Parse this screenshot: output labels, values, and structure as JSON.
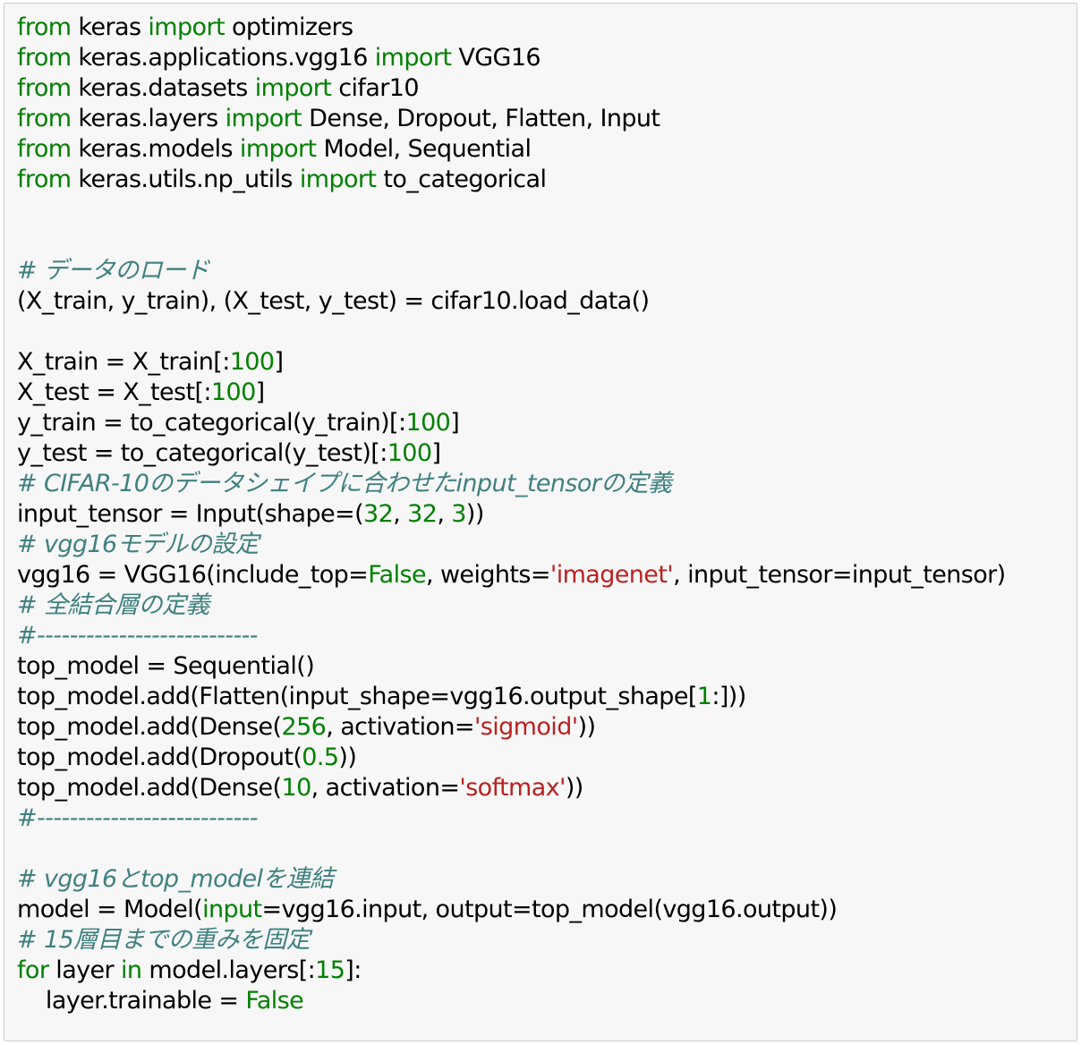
{
  "editor": {
    "colors": {
      "keyword": "#008000",
      "number": "#008000",
      "string": "#ba2121",
      "comment": "#408080",
      "text": "#000000",
      "background": "#f7f7f7",
      "border": "#cfcfcf"
    },
    "lines": [
      [
        {
          "t": "kw",
          "s": "from"
        },
        {
          "t": "tx",
          "s": " keras "
        },
        {
          "t": "kw",
          "s": "import"
        },
        {
          "t": "tx",
          "s": " optimizers"
        }
      ],
      [
        {
          "t": "kw",
          "s": "from"
        },
        {
          "t": "tx",
          "s": " keras.applications.vgg16 "
        },
        {
          "t": "kw",
          "s": "import"
        },
        {
          "t": "tx",
          "s": " VGG16"
        }
      ],
      [
        {
          "t": "kw",
          "s": "from"
        },
        {
          "t": "tx",
          "s": " keras.datasets "
        },
        {
          "t": "kw",
          "s": "import"
        },
        {
          "t": "tx",
          "s": " cifar10"
        }
      ],
      [
        {
          "t": "kw",
          "s": "from"
        },
        {
          "t": "tx",
          "s": " keras.layers "
        },
        {
          "t": "kw",
          "s": "import"
        },
        {
          "t": "tx",
          "s": " Dense, Dropout, Flatten, Input"
        }
      ],
      [
        {
          "t": "kw",
          "s": "from"
        },
        {
          "t": "tx",
          "s": " keras.models "
        },
        {
          "t": "kw",
          "s": "import"
        },
        {
          "t": "tx",
          "s": " Model, Sequential"
        }
      ],
      [
        {
          "t": "kw",
          "s": "from"
        },
        {
          "t": "tx",
          "s": " keras.utils.np_utils "
        },
        {
          "t": "kw",
          "s": "import"
        },
        {
          "t": "tx",
          "s": " to_categorical"
        }
      ],
      [],
      [],
      [
        {
          "t": "cm",
          "s": "# データのロード"
        }
      ],
      [
        {
          "t": "tx",
          "s": "(X_train, y_train), (X_test, y_test) = cifar10.load_data()"
        }
      ],
      [],
      [
        {
          "t": "tx",
          "s": "X_train = X_train[:"
        },
        {
          "t": "num",
          "s": "100"
        },
        {
          "t": "tx",
          "s": "]"
        }
      ],
      [
        {
          "t": "tx",
          "s": "X_test = X_test[:"
        },
        {
          "t": "num",
          "s": "100"
        },
        {
          "t": "tx",
          "s": "]"
        }
      ],
      [
        {
          "t": "tx",
          "s": "y_train = to_categorical(y_train)[:"
        },
        {
          "t": "num",
          "s": "100"
        },
        {
          "t": "tx",
          "s": "]"
        }
      ],
      [
        {
          "t": "tx",
          "s": "y_test = to_categorical(y_test)[:"
        },
        {
          "t": "num",
          "s": "100"
        },
        {
          "t": "tx",
          "s": "]"
        }
      ],
      [
        {
          "t": "cm",
          "s": "# CIFAR-10のデータシェイプに合わせたinput_tensorの定義"
        }
      ],
      [
        {
          "t": "tx",
          "s": "input_tensor = Input(shape=("
        },
        {
          "t": "num",
          "s": "32"
        },
        {
          "t": "tx",
          "s": ", "
        },
        {
          "t": "num",
          "s": "32"
        },
        {
          "t": "tx",
          "s": ", "
        },
        {
          "t": "num",
          "s": "3"
        },
        {
          "t": "tx",
          "s": "))"
        }
      ],
      [
        {
          "t": "cm",
          "s": "# vgg16モデルの設定"
        }
      ],
      [
        {
          "t": "tx",
          "s": "vgg16 = VGG16(include_top="
        },
        {
          "t": "kw",
          "s": "False"
        },
        {
          "t": "tx",
          "s": ", weights="
        },
        {
          "t": "str",
          "s": "'imagenet'"
        },
        {
          "t": "tx",
          "s": ", input_tensor=input_tensor)"
        }
      ],
      [
        {
          "t": "cm",
          "s": "# 全結合層の定義"
        }
      ],
      [
        {
          "t": "cm",
          "s": "#---------------------------"
        }
      ],
      [
        {
          "t": "tx",
          "s": "top_model = Sequential()"
        }
      ],
      [
        {
          "t": "tx",
          "s": "top_model.add(Flatten(input_shape=vgg16.output_shape["
        },
        {
          "t": "num",
          "s": "1"
        },
        {
          "t": "tx",
          "s": ":]))"
        }
      ],
      [
        {
          "t": "tx",
          "s": "top_model.add(Dense("
        },
        {
          "t": "num",
          "s": "256"
        },
        {
          "t": "tx",
          "s": ", activation="
        },
        {
          "t": "str",
          "s": "'sigmoid'"
        },
        {
          "t": "tx",
          "s": "))"
        }
      ],
      [
        {
          "t": "tx",
          "s": "top_model.add(Dropout("
        },
        {
          "t": "num",
          "s": "0.5"
        },
        {
          "t": "tx",
          "s": "))"
        }
      ],
      [
        {
          "t": "tx",
          "s": "top_model.add(Dense("
        },
        {
          "t": "num",
          "s": "10"
        },
        {
          "t": "tx",
          "s": ", activation="
        },
        {
          "t": "str",
          "s": "'softmax'"
        },
        {
          "t": "tx",
          "s": "))"
        }
      ],
      [
        {
          "t": "cm",
          "s": "#---------------------------"
        }
      ],
      [],
      [
        {
          "t": "cm",
          "s": "# vgg16とtop_modelを連結"
        }
      ],
      [
        {
          "t": "tx",
          "s": "model = Model("
        },
        {
          "t": "kw",
          "s": "input"
        },
        {
          "t": "tx",
          "s": "=vgg16.input, output=top_model(vgg16.output))"
        }
      ],
      [
        {
          "t": "cm",
          "s": "# 15層目までの重みを固定"
        }
      ],
      [
        {
          "t": "kw",
          "s": "for"
        },
        {
          "t": "tx",
          "s": " layer "
        },
        {
          "t": "kw",
          "s": "in"
        },
        {
          "t": "tx",
          "s": " model.layers[:"
        },
        {
          "t": "num",
          "s": "15"
        },
        {
          "t": "tx",
          "s": "]:"
        }
      ],
      [
        {
          "t": "tx",
          "s": "    layer.trainable = "
        },
        {
          "t": "kw",
          "s": "False"
        }
      ]
    ]
  }
}
